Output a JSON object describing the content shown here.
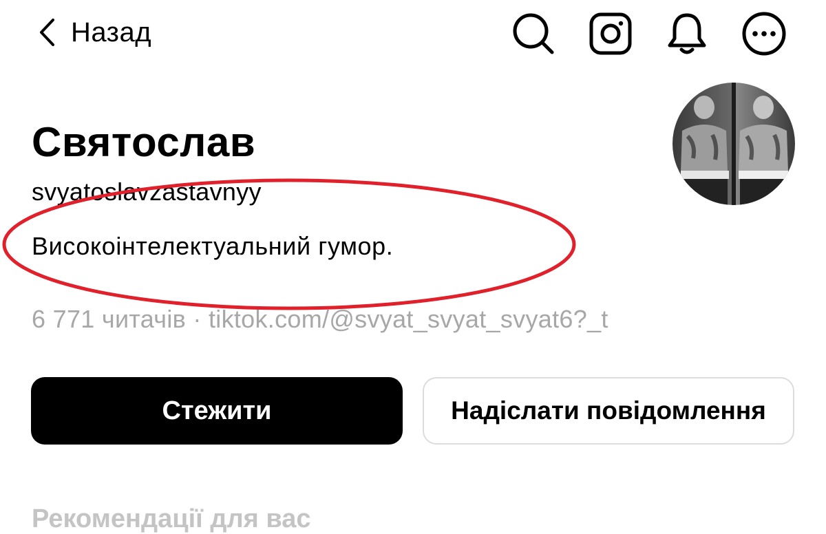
{
  "header": {
    "back_label": "Назад",
    "icons": [
      "search-icon",
      "instagram-icon",
      "bell-icon",
      "more-icon"
    ]
  },
  "profile": {
    "display_name": "Святослав",
    "username": "svyatoslavzastavnyy",
    "bio": "Високоінтелектуальний гумор.",
    "followers": "6 771 читачів",
    "separator": "·",
    "link": "tiktok.com/@svyat_svyat_svyat6?_t"
  },
  "actions": {
    "follow_label": "Стежити",
    "message_label": "Надіслати повідомлення"
  },
  "recommendations": {
    "heading": "Рекомендації для вас"
  },
  "colors": {
    "annotation_red": "#e0202a",
    "muted_text": "#a7a7a7",
    "button_dark": "#000000"
  }
}
